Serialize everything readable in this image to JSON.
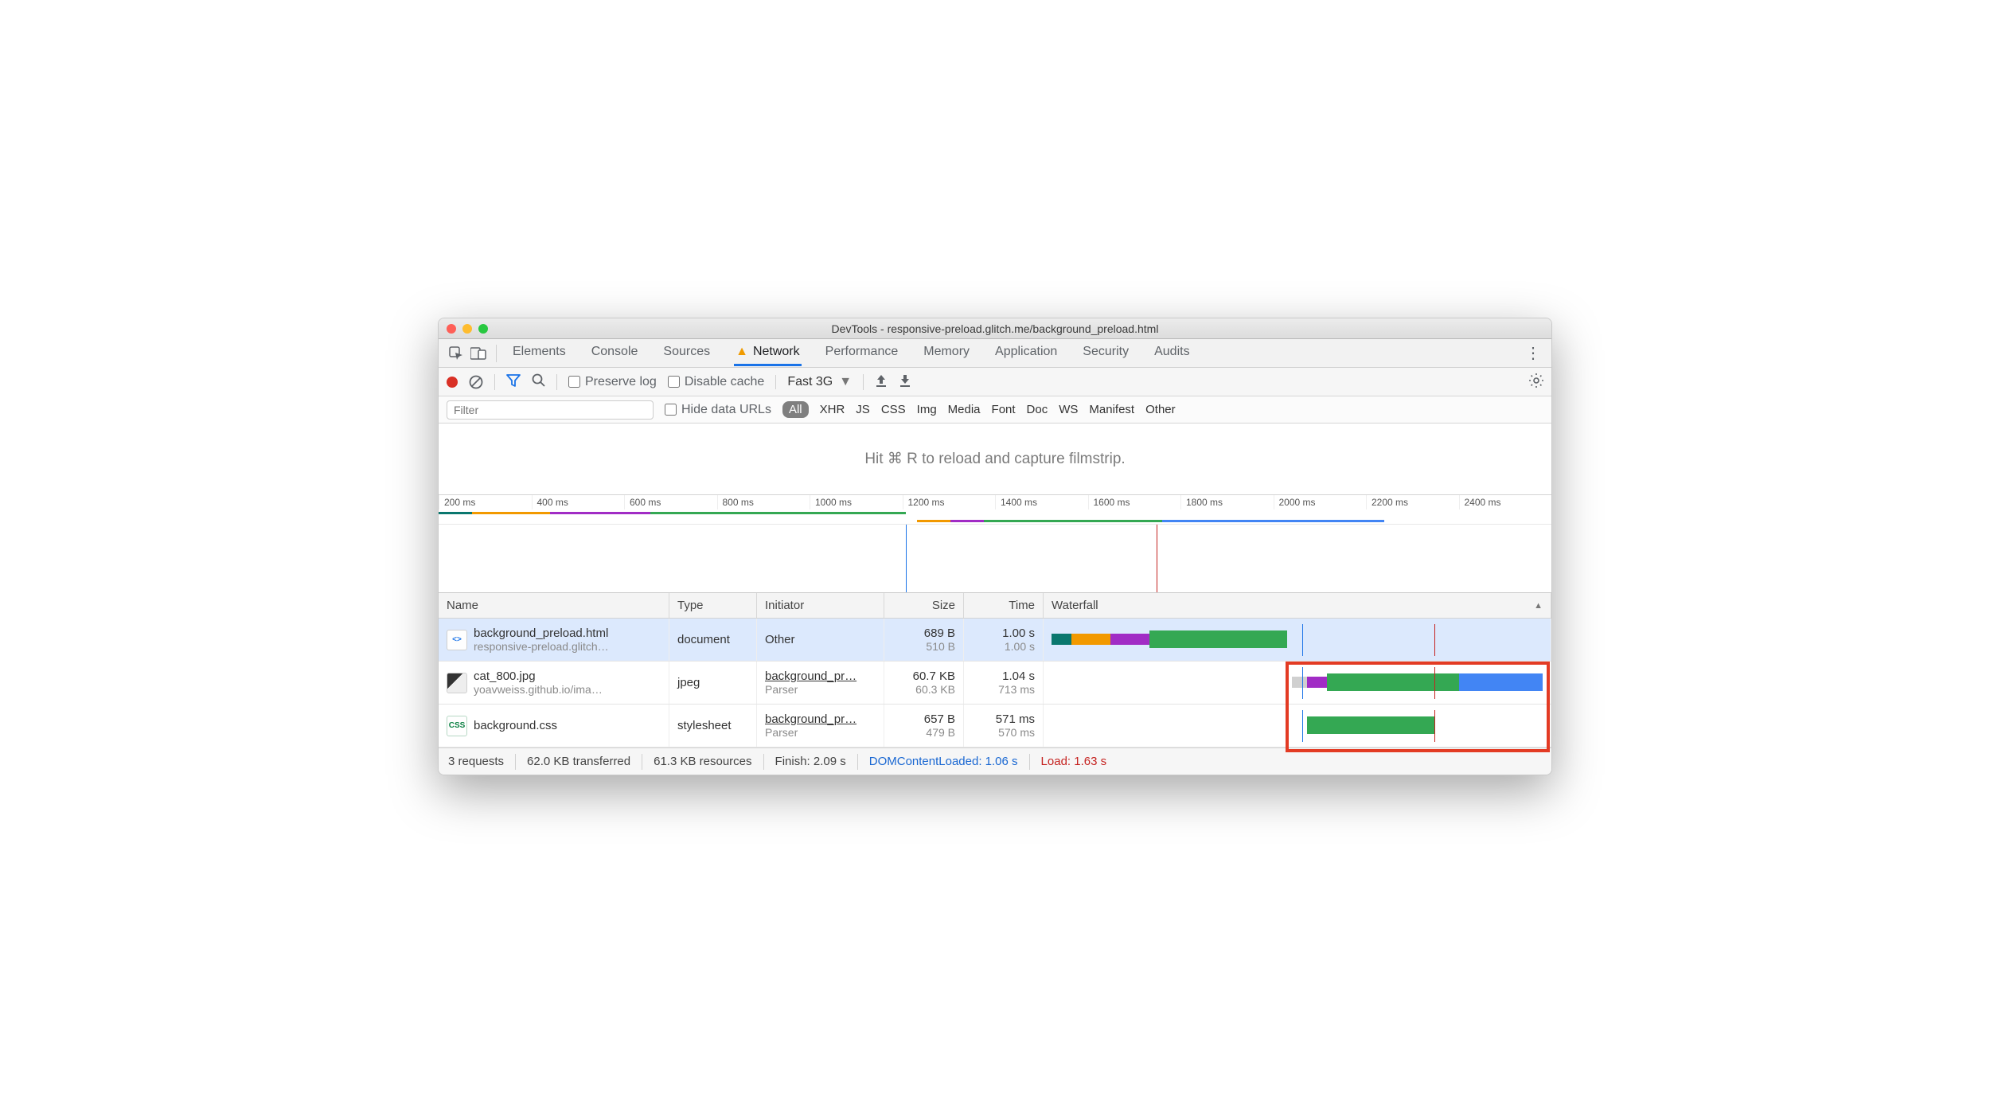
{
  "window": {
    "title": "DevTools - responsive-preload.glitch.me/background_preload.html"
  },
  "panel_tabs": {
    "items": [
      {
        "label": "Elements"
      },
      {
        "label": "Console"
      },
      {
        "label": "Sources"
      },
      {
        "label": "Network",
        "active": true,
        "warning": true
      },
      {
        "label": "Performance"
      },
      {
        "label": "Memory"
      },
      {
        "label": "Application"
      },
      {
        "label": "Security"
      },
      {
        "label": "Audits"
      }
    ]
  },
  "toolbar": {
    "preserve_log_label": "Preserve log",
    "disable_cache_label": "Disable cache",
    "throttle_label": "Fast 3G"
  },
  "filter_row": {
    "placeholder": "Filter",
    "hide_data_urls_label": "Hide data URLs",
    "all_label": "All",
    "types": [
      "XHR",
      "JS",
      "CSS",
      "Img",
      "Media",
      "Font",
      "Doc",
      "WS",
      "Manifest",
      "Other"
    ]
  },
  "banner": {
    "text": "Hit ⌘ R to reload and capture filmstrip."
  },
  "overview": {
    "ticks": [
      "200 ms",
      "400 ms",
      "600 ms",
      "800 ms",
      "1000 ms",
      "1200 ms",
      "1400 ms",
      "1600 ms",
      "1800 ms",
      "2000 ms",
      "2200 ms",
      "2400 ms"
    ],
    "dcl_pct": 42.0,
    "load_pct": 64.5,
    "stream1": [
      {
        "color": "#0a776e",
        "start": 0,
        "end": 3
      },
      {
        "color": "#f29900",
        "start": 3,
        "end": 10
      },
      {
        "color": "#a12cc5",
        "start": 10,
        "end": 19
      },
      {
        "color": "#34a853",
        "start": 19,
        "end": 42
      }
    ],
    "stream2": [
      {
        "color": "#f29900",
        "start": 43,
        "end": 46
      },
      {
        "color": "#a12cc5",
        "start": 46,
        "end": 49
      },
      {
        "color": "#34a853",
        "start": 49,
        "end": 65
      },
      {
        "color": "#4285f4",
        "start": 65,
        "end": 85
      }
    ]
  },
  "table": {
    "headers": {
      "name": "Name",
      "type": "Type",
      "initiator": "Initiator",
      "size": "Size",
      "time": "Time",
      "waterfall": "Waterfall"
    },
    "rows": [
      {
        "selected": true,
        "icon": "html",
        "name": "background_preload.html",
        "name_sub": "responsive-preload.glitch…",
        "type": "document",
        "initiator": "Other",
        "initiator_sub": "",
        "size": "689 B",
        "size_sub": "510 B",
        "time": "1.00 s",
        "time_sub": "1.00 s",
        "wf": [
          {
            "color": "#0a776e",
            "start": 0,
            "end": 4
          },
          {
            "color": "#f29900",
            "start": 4,
            "end": 12
          },
          {
            "color": "#a12cc5",
            "start": 12,
            "end": 20
          },
          {
            "color": "#34a853",
            "start": 20,
            "end": 48,
            "tall": true
          }
        ]
      },
      {
        "selected": false,
        "icon": "img",
        "name": "cat_800.jpg",
        "name_sub": "yoavweiss.github.io/ima…",
        "type": "jpeg",
        "initiator": "background_pr…",
        "initiator_sub": "Parser",
        "initiator_link": true,
        "size": "60.7 KB",
        "size_sub": "60.3 KB",
        "time": "1.04 s",
        "time_sub": "713 ms",
        "wf": [
          {
            "color": "#d0d0d0",
            "start": 49,
            "end": 52
          },
          {
            "color": "#a12cc5",
            "start": 52,
            "end": 56
          },
          {
            "color": "#34a853",
            "start": 56,
            "end": 83,
            "tall": true
          },
          {
            "color": "#4285f4",
            "start": 83,
            "end": 100,
            "tall": true
          }
        ]
      },
      {
        "selected": false,
        "icon": "css",
        "name": "background.css",
        "name_sub": "",
        "type": "stylesheet",
        "initiator": "background_pr…",
        "initiator_sub": "Parser",
        "initiator_link": true,
        "size": "657 B",
        "size_sub": "479 B",
        "time": "571 ms",
        "time_sub": "570 ms",
        "wf": [
          {
            "color": "#34a853",
            "start": 52,
            "end": 78,
            "tall": true
          }
        ]
      }
    ]
  },
  "status": {
    "requests": "3 requests",
    "transferred": "62.0 KB transferred",
    "resources": "61.3 KB resources",
    "finish": "Finish: 2.09 s",
    "dcl": "DOMContentLoaded: 1.06 s",
    "load": "Load: 1.63 s"
  },
  "highlight_box": {
    "left_pct": 48,
    "width_pct": 52,
    "top_row": 1,
    "rows": 2
  }
}
